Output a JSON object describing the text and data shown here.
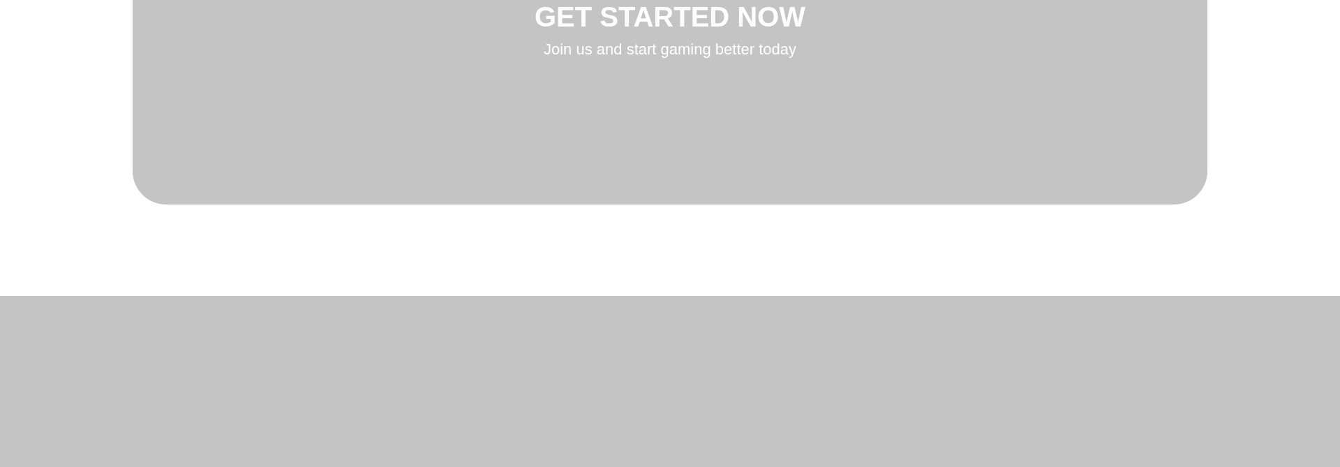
{
  "cta": {
    "title": "GET STARTED NOW",
    "subtitle": "Join us and start gaming better today"
  }
}
